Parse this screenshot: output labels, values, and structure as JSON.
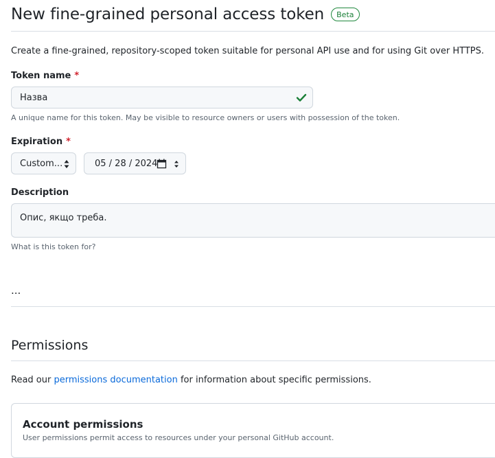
{
  "header": {
    "title": "New fine-grained personal access token",
    "badge": "Beta"
  },
  "intro": "Create a fine-grained, repository-scoped token suitable for personal API use and for using Git over HTTPS.",
  "token_name": {
    "label": "Token name",
    "required_mark": "*",
    "value": "Назва",
    "note": "A unique name for this token. May be visible to resource owners or users with possession of the token."
  },
  "expiration": {
    "label": "Expiration",
    "required_mark": "*",
    "select_value": "Custom...",
    "date_value": "05 / 28 / 2024"
  },
  "description": {
    "label": "Description",
    "value": "Опис, якщо треба.",
    "note": "What is this token for?"
  },
  "ellipsis": "...",
  "permissions": {
    "title": "Permissions",
    "text_before": "Read our ",
    "link": "permissions documentation",
    "text_after": " for information about specific permissions."
  },
  "account_permissions": {
    "title": "Account permissions",
    "subtitle": "User permissions permit access to resources under your personal GitHub account."
  },
  "colors": {
    "accent_link": "#0969da",
    "success": "#1a7f37",
    "required": "#d1242f"
  }
}
